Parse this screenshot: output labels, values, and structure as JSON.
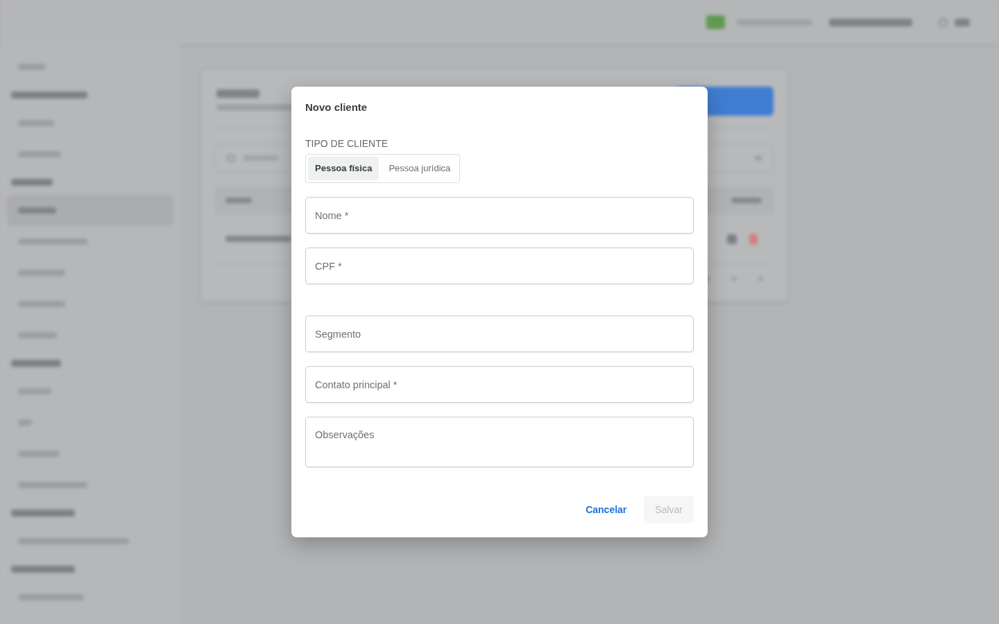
{
  "dialog": {
    "title": "Novo cliente",
    "client_type": {
      "label": "TIPO DE CLIENTE",
      "options": [
        {
          "label": "Pessoa física",
          "selected": true
        },
        {
          "label": "Pessoa jurídica",
          "selected": false
        }
      ]
    },
    "sections": [
      {
        "fields": [
          {
            "kind": "text",
            "placeholder": "Nome *"
          },
          {
            "kind": "text",
            "placeholder": "CPF *"
          }
        ]
      },
      {
        "fields": [
          {
            "kind": "text",
            "placeholder": "Segmento"
          },
          {
            "kind": "text",
            "placeholder": "Contato principal *"
          },
          {
            "kind": "textarea",
            "placeholder": "Observações"
          }
        ]
      }
    ],
    "actions": [
      {
        "kind": "text",
        "label": "Cancelar",
        "disabled": false
      },
      {
        "kind": "contained",
        "label": "Salvar",
        "disabled": true
      }
    ]
  }
}
